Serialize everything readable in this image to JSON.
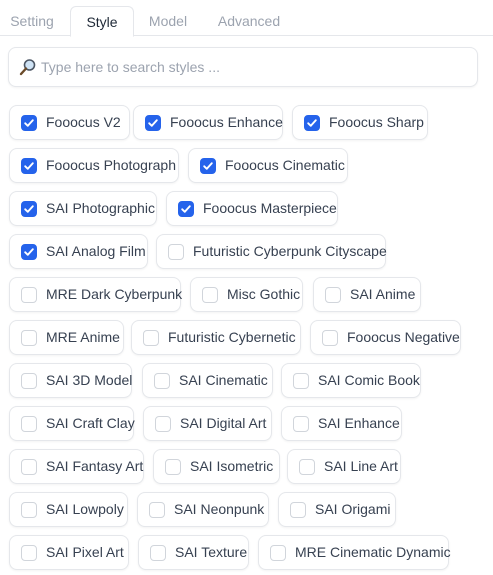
{
  "tabs": [
    {
      "label": "Setting",
      "active": false
    },
    {
      "label": "Style",
      "active": true
    },
    {
      "label": "Model",
      "active": false
    },
    {
      "label": "Advanced",
      "active": false
    }
  ],
  "search": {
    "placeholder": "Type here to search styles ...",
    "value": ""
  },
  "colors": {
    "accent": "#2563eb",
    "border": "#e5e7eb",
    "text": "#374151",
    "muted": "#9ca3af"
  },
  "styles": [
    {
      "label": "Fooocus V2",
      "checked": true
    },
    {
      "label": "Fooocus Enhance",
      "checked": true
    },
    {
      "label": "Fooocus Sharp",
      "checked": true
    },
    {
      "label": "Fooocus Photograph",
      "checked": true
    },
    {
      "label": "Fooocus Cinematic",
      "checked": true
    },
    {
      "label": "SAI Photographic",
      "checked": true
    },
    {
      "label": "Fooocus Masterpiece",
      "checked": true
    },
    {
      "label": "SAI Analog Film",
      "checked": true
    },
    {
      "label": "Futuristic Cyberpunk Cityscape",
      "checked": false
    },
    {
      "label": "MRE Dark Cyberpunk",
      "checked": false
    },
    {
      "label": "Misc Gothic",
      "checked": false
    },
    {
      "label": "SAI Anime",
      "checked": false
    },
    {
      "label": "MRE Anime",
      "checked": false
    },
    {
      "label": "Futuristic Cybernetic",
      "checked": false
    },
    {
      "label": "Fooocus Negative",
      "checked": false
    },
    {
      "label": "SAI 3D Model",
      "checked": false
    },
    {
      "label": "SAI Cinematic",
      "checked": false
    },
    {
      "label": "SAI Comic Book",
      "checked": false
    },
    {
      "label": "SAI Craft Clay",
      "checked": false
    },
    {
      "label": "SAI Digital Art",
      "checked": false
    },
    {
      "label": "SAI Enhance",
      "checked": false
    },
    {
      "label": "SAI Fantasy Art",
      "checked": false
    },
    {
      "label": "SAI Isometric",
      "checked": false
    },
    {
      "label": "SAI Line Art",
      "checked": false
    },
    {
      "label": "SAI Lowpoly",
      "checked": false
    },
    {
      "label": "SAI Neonpunk",
      "checked": false
    },
    {
      "label": "SAI Origami",
      "checked": false
    },
    {
      "label": "SAI Pixel Art",
      "checked": false
    },
    {
      "label": "SAI Texture",
      "checked": false
    },
    {
      "label": "MRE Cinematic Dynamic",
      "checked": false
    }
  ]
}
